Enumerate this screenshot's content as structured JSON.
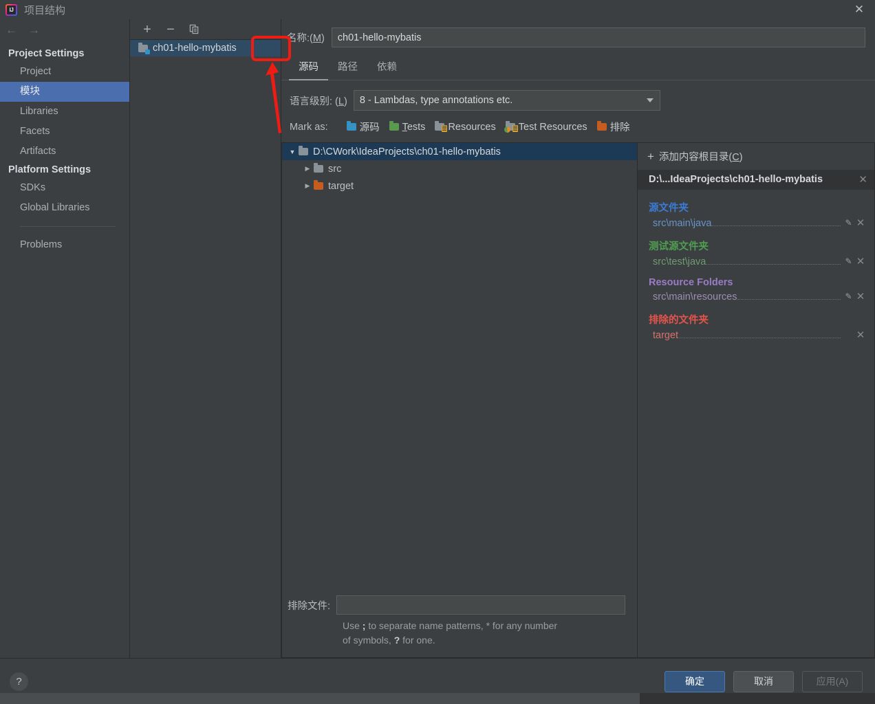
{
  "window": {
    "title": "项目结构",
    "logo_text": "IJ",
    "close_label": "✕"
  },
  "sidebar": {
    "back_icon": "←",
    "forward_icon": "→",
    "groups": [
      {
        "label": "Project Settings",
        "items": [
          {
            "label": "Project",
            "selected": false
          },
          {
            "label": "模块",
            "selected": true
          },
          {
            "label": "Libraries",
            "selected": false
          },
          {
            "label": "Facets",
            "selected": false
          },
          {
            "label": "Artifacts",
            "selected": false
          }
        ]
      },
      {
        "label": "Platform Settings",
        "items": [
          {
            "label": "SDKs",
            "selected": false
          },
          {
            "label": "Global Libraries",
            "selected": false
          }
        ]
      }
    ],
    "problems_label": "Problems"
  },
  "module_panel": {
    "toolbar": {
      "add_label": "+",
      "remove_label": "−",
      "copy_label": "copy-icon"
    },
    "modules": [
      {
        "name": "ch01-hello-mybatis",
        "selected": true
      }
    ]
  },
  "annotation": {
    "highlight_target": "add-module-button",
    "color": "#ee1c13"
  },
  "detail": {
    "name_label_prefix": "名称:(",
    "name_label_key": "M",
    "name_label_suffix": ")",
    "name_value": "ch01-hello-mybatis",
    "tabs": [
      {
        "label": "源码",
        "active": true
      },
      {
        "label": "路径",
        "active": false
      },
      {
        "label": "依赖",
        "active": false
      }
    ],
    "language_level": {
      "label_prefix": "语言级别:",
      "label_key": "L",
      "value": "8 - Lambdas, type annotations etc."
    },
    "mark_as": {
      "label": "Mark as:",
      "options": [
        {
          "label": "源码",
          "icon": "folder-blue",
          "underline": ""
        },
        {
          "label": "Tests",
          "icon": "folder-green",
          "underline": "T"
        },
        {
          "label": "Resources",
          "icon": "folder-gray-resource",
          "underline": ""
        },
        {
          "label": "Test Resources",
          "icon": "folder-test-resource",
          "underline": ""
        },
        {
          "label": "排除",
          "icon": "folder-orange",
          "underline": ""
        }
      ]
    },
    "tree": [
      {
        "label": "D:\\CWork\\IdeaProjects\\ch01-hello-mybatis",
        "icon": "folder-gray",
        "depth": 0,
        "twisty": "▼",
        "selected": true
      },
      {
        "label": "src",
        "icon": "folder-gray",
        "depth": 1,
        "twisty": "▶",
        "selected": false
      },
      {
        "label": "target",
        "icon": "folder-orange",
        "depth": 1,
        "twisty": "▶",
        "selected": false
      }
    ],
    "exclude_files": {
      "label": "排除文件:",
      "value": "",
      "hint_a": "Use ",
      "hint_semicolon": ";",
      "hint_b": " to separate name patterns, * for any number of symbols, ",
      "hint_question": "?",
      "hint_c": " for one."
    }
  },
  "roots": {
    "add_label_prefix": "添加内容根目录(",
    "add_label_key": "C",
    "add_label_suffix": ")",
    "add_icon": "plus-icon",
    "header_path": "D:\\...IdeaProjects\\ch01-hello-mybatis",
    "header_close": "✕",
    "groups": [
      {
        "title": "源文件夹",
        "color": "#3a7bd5",
        "entry_color": "#6a93c8",
        "entries": [
          {
            "path": "src\\main\\java",
            "has_edit": true,
            "has_remove": true
          }
        ]
      },
      {
        "title": "测试源文件夹",
        "color": "#4f9e50",
        "entry_color": "#6f9b70",
        "entries": [
          {
            "path": "src\\test\\java",
            "has_edit": true,
            "has_remove": true
          }
        ]
      },
      {
        "title": "Resource Folders",
        "color": "#9a7cc4",
        "entry_color": "#9b8eb0",
        "entries": [
          {
            "path": "src\\main\\resources",
            "has_edit": true,
            "has_remove": true
          }
        ]
      },
      {
        "title": "排除的文件夹",
        "color": "#e4544b",
        "entry_color": "#d4726c",
        "entries": [
          {
            "path": "target",
            "has_edit": false,
            "has_remove": true
          }
        ]
      }
    ],
    "edit_icon": "✎",
    "remove_icon": "✕"
  },
  "footer": {
    "help_label": "?",
    "buttons": [
      {
        "label": "确定",
        "style": "primary",
        "disabled": false
      },
      {
        "label": "取消",
        "style": "default",
        "disabled": false
      },
      {
        "label": "应用(A)",
        "style": "disabled",
        "disabled": true
      }
    ]
  }
}
